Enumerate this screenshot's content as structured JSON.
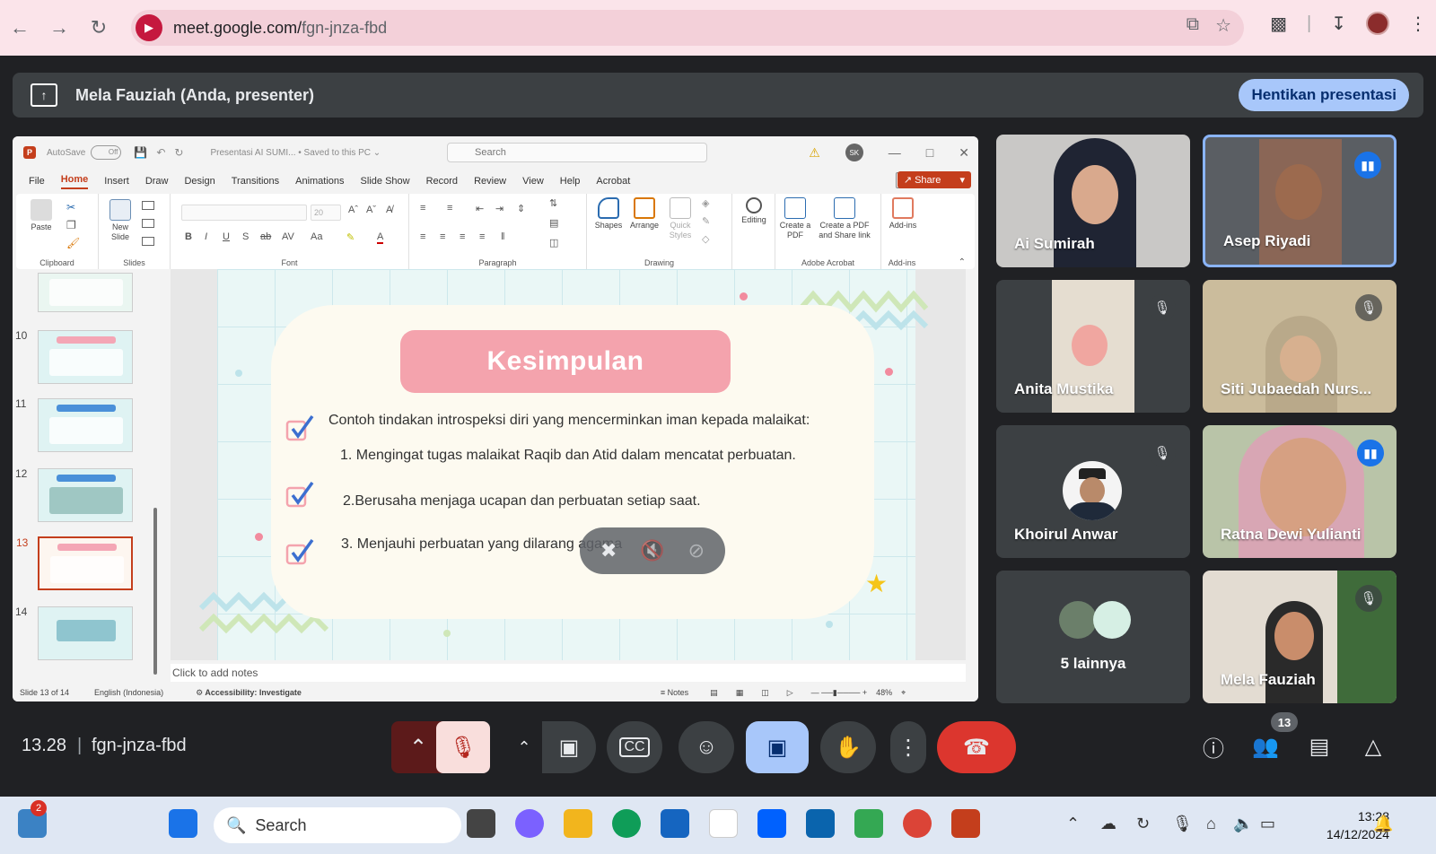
{
  "browser": {
    "url_host": "meet.google.com/",
    "url_path": "fgn-jnza-fbd"
  },
  "banner": {
    "presenter_text": "Mela Fauziah (Anda, presenter)",
    "stop_label": "Hentikan presentasi"
  },
  "ppt": {
    "autosave_label": "AutoSave",
    "autosave_state": "Off",
    "doc_title": "Presentasi AI SUMI...  •  Saved to this PC ⌄",
    "search_placeholder": "Search",
    "user_initials": "SK",
    "menu": [
      "File",
      "Home",
      "Insert",
      "Draw",
      "Design",
      "Transitions",
      "Animations",
      "Slide Show",
      "Record",
      "Review",
      "View",
      "Help",
      "Acrobat"
    ],
    "share_label": "Share",
    "ribbon": {
      "paste": "Paste",
      "new_slide": "New Slide",
      "shapes": "Shapes",
      "arrange": "Arrange",
      "quick_styles": "Quick Styles",
      "editing": "Editing",
      "create_pdf": "Create a PDF",
      "create_pdf_share": "Create a PDF and Share link",
      "addins": "Add-ins",
      "font_size": "20",
      "groups": [
        "Clipboard",
        "Slides",
        "Font",
        "Paragraph",
        "Drawing",
        "Adobe Acrobat",
        "Add-ins"
      ]
    },
    "thumb_numbers": [
      "10",
      "11",
      "12",
      "13",
      "14"
    ],
    "slide": {
      "title": "Kesimpulan",
      "intro": "Contoh tindakan introspeksi diri yang mencerminkan iman kepada malaikat:",
      "item1": "1. Mengingat tugas malaikat Raqib dan Atid dalam mencatat perbuatan.",
      "item2": "2.Berusaha menjaga ucapan dan perbuatan setiap saat.",
      "item3": "3. Menjauhi perbuatan yang dilarang agama"
    },
    "notes_placeholder": "Click to add notes",
    "status": {
      "slide_of": "Slide 13 of 14",
      "language": "English (Indonesia)",
      "accessibility": "Accessibility: Investigate",
      "notes": "Notes",
      "zoom": "48%"
    }
  },
  "participants": [
    {
      "name": "Ai Sumirah",
      "muted": false,
      "speaking": false
    },
    {
      "name": "Asep Riyadi",
      "muted": false,
      "speaking": true
    },
    {
      "name": "Anita Mustika",
      "muted": true,
      "speaking": false
    },
    {
      "name": "Siti Jubaedah Nurs...",
      "muted": true,
      "speaking": false
    },
    {
      "name": "Khoirul Anwar",
      "muted": true,
      "speaking": false
    },
    {
      "name": "Ratna Dewi Yulianti",
      "muted": false,
      "speaking": true
    },
    {
      "name": "5 lainnya",
      "muted": false,
      "speaking": false
    },
    {
      "name": "Mela Fauziah",
      "muted": true,
      "speaking": false
    }
  ],
  "meet": {
    "time": "13.28",
    "code": "fgn-jnza-fbd",
    "participant_count": "13"
  },
  "taskbar": {
    "search_label": "Search",
    "notif_badge": "2",
    "time": "13:28",
    "date": "14/12/2024"
  }
}
